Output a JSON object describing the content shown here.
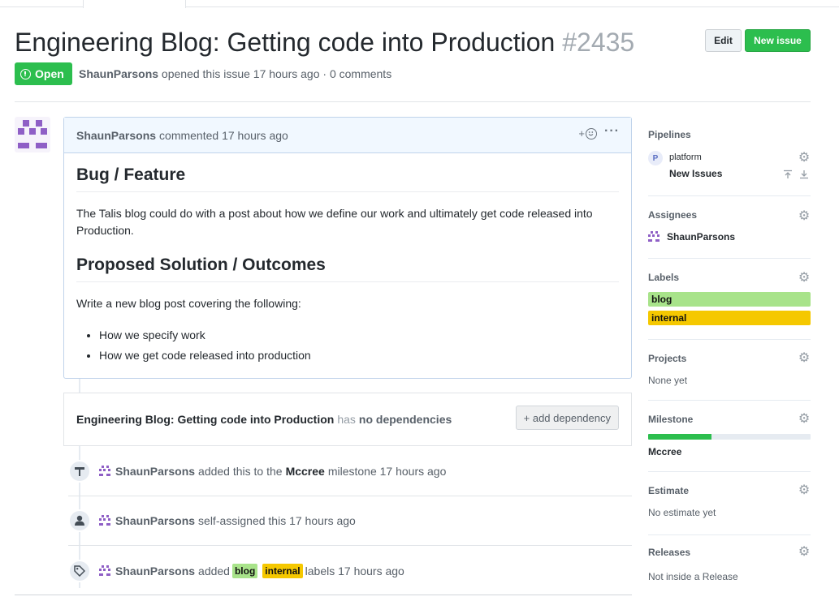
{
  "issue": {
    "title": "Engineering Blog: Getting code into Production",
    "number": "#2435",
    "state": "Open",
    "author": "ShaunParsons",
    "opened_text": "opened this issue 17 hours ago · 0 comments"
  },
  "header_buttons": {
    "edit": "Edit",
    "new_issue": "New issue"
  },
  "comment": {
    "author": "ShaunParsons",
    "time_text": "commented 17 hours ago",
    "reaction_plus": "+",
    "more": "···",
    "heading1": "Bug / Feature",
    "para1": "The Talis blog could do with a post about how we define our work and ultimately get code released into Production.",
    "heading2": "Proposed Solution / Outcomes",
    "para2": "Write a new blog post covering the following:",
    "bullets": [
      "How we specify work",
      "How we get code released into production"
    ]
  },
  "dependency": {
    "title": "Engineering Blog: Getting code into Production",
    "has": "has",
    "status": "no dependencies",
    "button": "+ add dependency"
  },
  "events": [
    {
      "icon": "milestone-icon",
      "user": "ShaunParsons",
      "pre": "added this to the",
      "target": "Mccree",
      "post": "milestone 17 hours ago"
    },
    {
      "icon": "person-icon",
      "user": "ShaunParsons",
      "text": "self-assigned this 17 hours ago"
    },
    {
      "icon": "tag-icon",
      "user": "ShaunParsons",
      "pre": "added",
      "labels": [
        "blog",
        "internal"
      ],
      "post": "labels 17 hours ago"
    }
  ],
  "sidebar": {
    "pipelines": {
      "title": "Pipelines",
      "badge": "P",
      "workspace": "platform",
      "pipeline": "New Issues"
    },
    "assignees": {
      "title": "Assignees",
      "user": "ShaunParsons"
    },
    "labels": {
      "title": "Labels",
      "items": [
        {
          "name": "blog",
          "color": "#a8e38a"
        },
        {
          "name": "internal",
          "color": "#f5c800"
        }
      ]
    },
    "projects": {
      "title": "Projects",
      "value": "None yet"
    },
    "milestone": {
      "title": "Milestone",
      "name": "Mccree",
      "progress_percent": 39
    },
    "estimate": {
      "title": "Estimate",
      "value": "No estimate yet"
    },
    "releases": {
      "title": "Releases",
      "value": "Not inside a Release"
    }
  },
  "colors": {
    "open_green": "#2cbe4e",
    "label_blog": "#a8e38a",
    "label_internal": "#f5c800",
    "avatar_purple": "#8f5fc6"
  }
}
